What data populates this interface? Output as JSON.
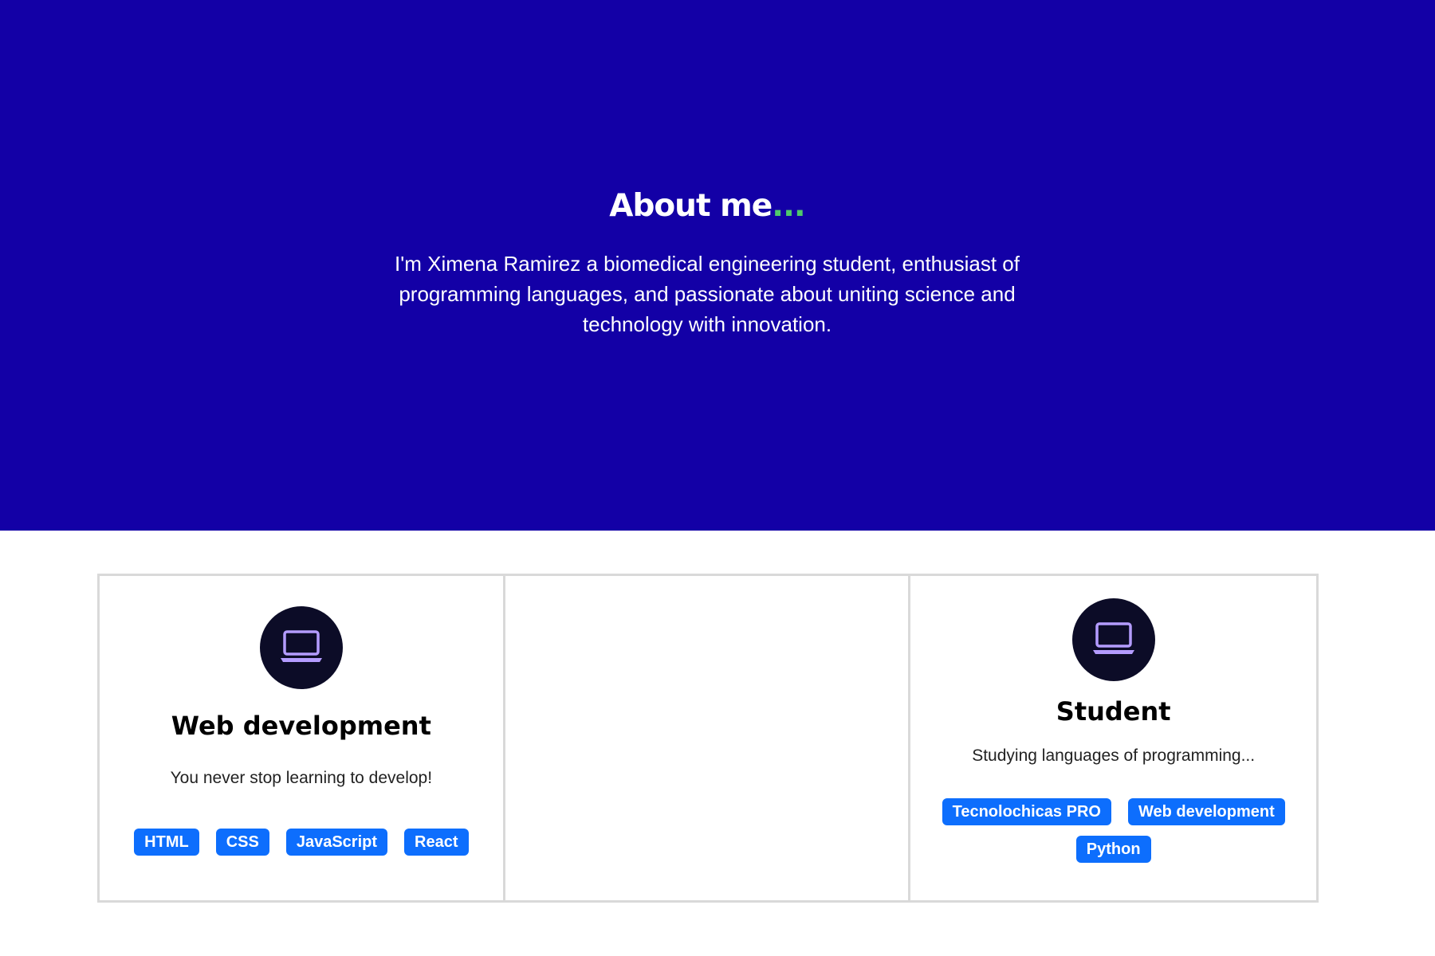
{
  "hero": {
    "title": "About me",
    "title_suffix": "...",
    "description": "I'm Ximena Ramirez a biomedical engineering student, enthusiast of programming languages, and passionate about uniting science and technology with innovation."
  },
  "cards": [
    {
      "icon": "laptop-icon",
      "title": "Web development",
      "description": "You never stop learning to develop!",
      "tags": [
        "HTML",
        "CSS",
        "JavaScript",
        "React"
      ]
    },
    {
      "empty": true
    },
    {
      "icon": "laptop-icon",
      "title": "Student",
      "description": "Studying languages of programming...",
      "tags": [
        "Tecnolochicas PRO",
        "Web development",
        "Python"
      ]
    }
  ],
  "colors": {
    "hero_background": "#1300a6",
    "accent_dots": "#4fc96b",
    "tag_background": "#0d6efd",
    "icon_circle": "#0c0c27",
    "icon_stroke": "#b49cff"
  }
}
